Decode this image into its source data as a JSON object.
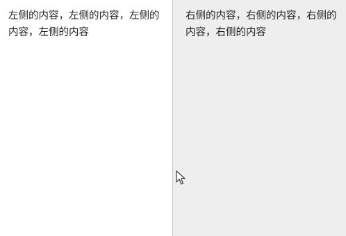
{
  "left_pane": {
    "text": "左侧的内容，左侧的内容，左侧的内容，左侧的内容"
  },
  "right_pane": {
    "text": "右侧的内容，右侧的内容，右侧的内容，右侧的内容"
  },
  "colors": {
    "left_background": "#ffffff",
    "right_background": "#eeeeee",
    "divider": "#c8c8c8",
    "text": "#222222"
  },
  "cursor": {
    "icon": "arrow-pointer-icon"
  }
}
